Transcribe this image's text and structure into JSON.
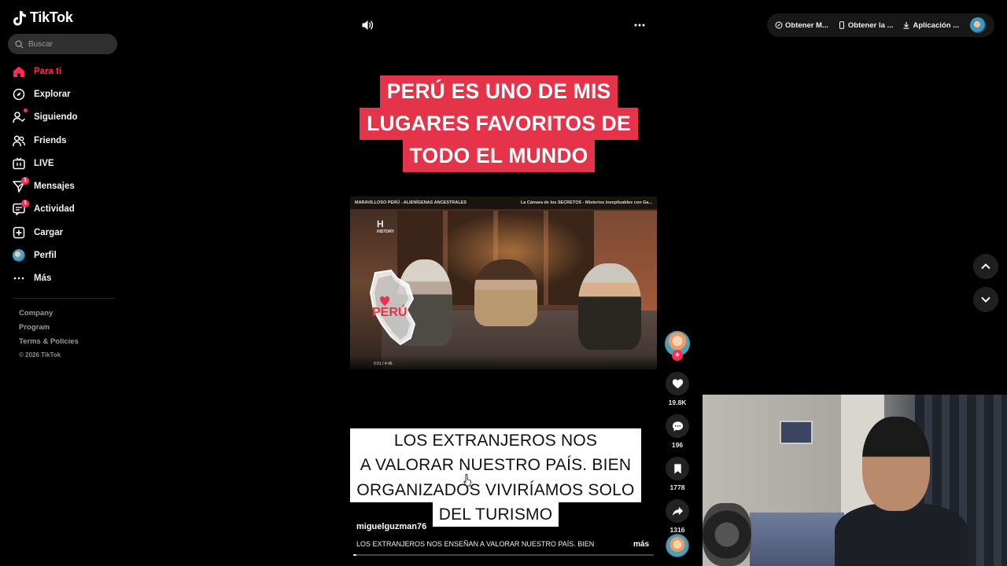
{
  "brand": {
    "name": "TikTok"
  },
  "search": {
    "placeholder": "Buscar"
  },
  "nav": {
    "items": [
      {
        "label": "Para ti",
        "icon": "home-icon",
        "active": true
      },
      {
        "label": "Explorar",
        "icon": "compass-icon"
      },
      {
        "label": "Siguiendo",
        "icon": "following-icon"
      },
      {
        "label": "Friends",
        "icon": "friends-icon"
      },
      {
        "label": "LIVE",
        "icon": "live-icon"
      },
      {
        "label": "Mensajes",
        "icon": "messages-icon",
        "badge": "1"
      },
      {
        "label": "Actividad",
        "icon": "activity-icon",
        "badge": "1"
      },
      {
        "label": "Cargar",
        "icon": "upload-icon"
      },
      {
        "label": "Perfil",
        "icon": "profile-avatar"
      },
      {
        "label": "Más",
        "icon": "more-icon"
      }
    ]
  },
  "footer": {
    "links": [
      "Company",
      "Program",
      "Terms & Policies"
    ],
    "copyright": "© 2026 TikTok"
  },
  "topbar": {
    "item1": "Obtener M...",
    "item2": "Obtener la ...",
    "item3": "Aplicación ..."
  },
  "video": {
    "caption_top": [
      "PERÚ ES UNO DE MIS",
      "LUGARES FAVORITOS DE",
      "TODO EL MUNDO"
    ],
    "embedded_title": "MARAVILLOSO PERÚ - ALIENÍGENAS ANCESTRALES",
    "embedded_right": "La Cámara de los SECRETOS - Misterios inexplicables con Ga...",
    "embedded_logo": "H",
    "embedded_logo_sub": "HISTORY",
    "embedded_stamp": "PERÚ",
    "embedded_time": "0:01 / 4:46",
    "caption_bottom": [
      "LOS EXTRANJEROS NOS ENSEÑAN",
      "A VALORAR NUESTRO PAÍS. BIEN",
      "ORGANIZADOS VIVIRÍAMOS SOLO",
      "DEL TURISMO"
    ],
    "author": "miguelguzman76",
    "description": "LOS EXTRANJEROS NOS ENSEÑAN A VALORAR NUESTRO PAÍS. BIEN",
    "more_label": "más",
    "progress": 0.01
  },
  "rail": {
    "likes": "19.8K",
    "comments": "196",
    "saves": "1778",
    "shares": "1316"
  },
  "colors": {
    "accent": "#fe2c55",
    "caption_top_bg": "#e5334a",
    "caption_bottom_bg": "#ffffff"
  }
}
